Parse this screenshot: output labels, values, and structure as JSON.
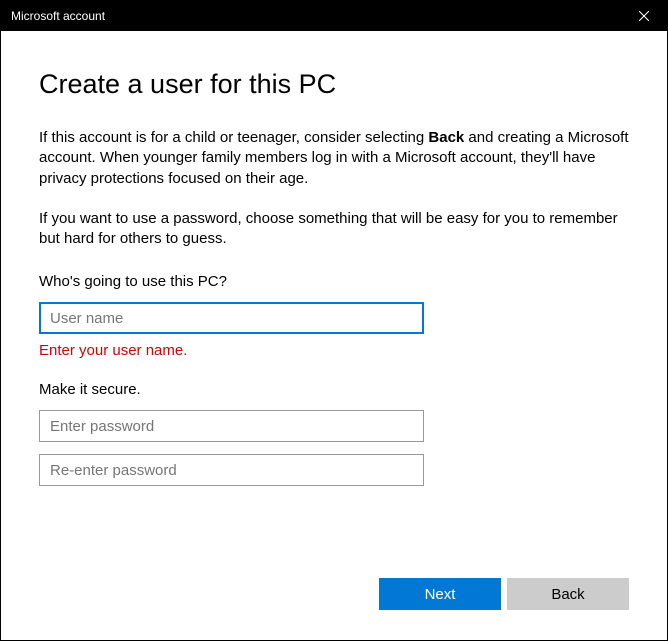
{
  "titlebar": {
    "title": "Microsoft account"
  },
  "main": {
    "heading": "Create a user for this PC",
    "description1_pre": "If this account is for a child or teenager, consider selecting ",
    "description1_bold": "Back",
    "description1_post": " and creating a Microsoft account. When younger family members log in with a Microsoft account, they'll have privacy protections focused on their age.",
    "description2": "If you want to use a password, choose something that will be easy for you to remember but hard for others to guess.",
    "username_section_label": "Who's going to use this PC?",
    "username_placeholder": "User name",
    "username_error": "Enter your user name.",
    "password_section_label": "Make it secure.",
    "password_placeholder": "Enter password",
    "confirm_password_placeholder": "Re-enter password"
  },
  "buttons": {
    "next": "Next",
    "back": "Back"
  }
}
